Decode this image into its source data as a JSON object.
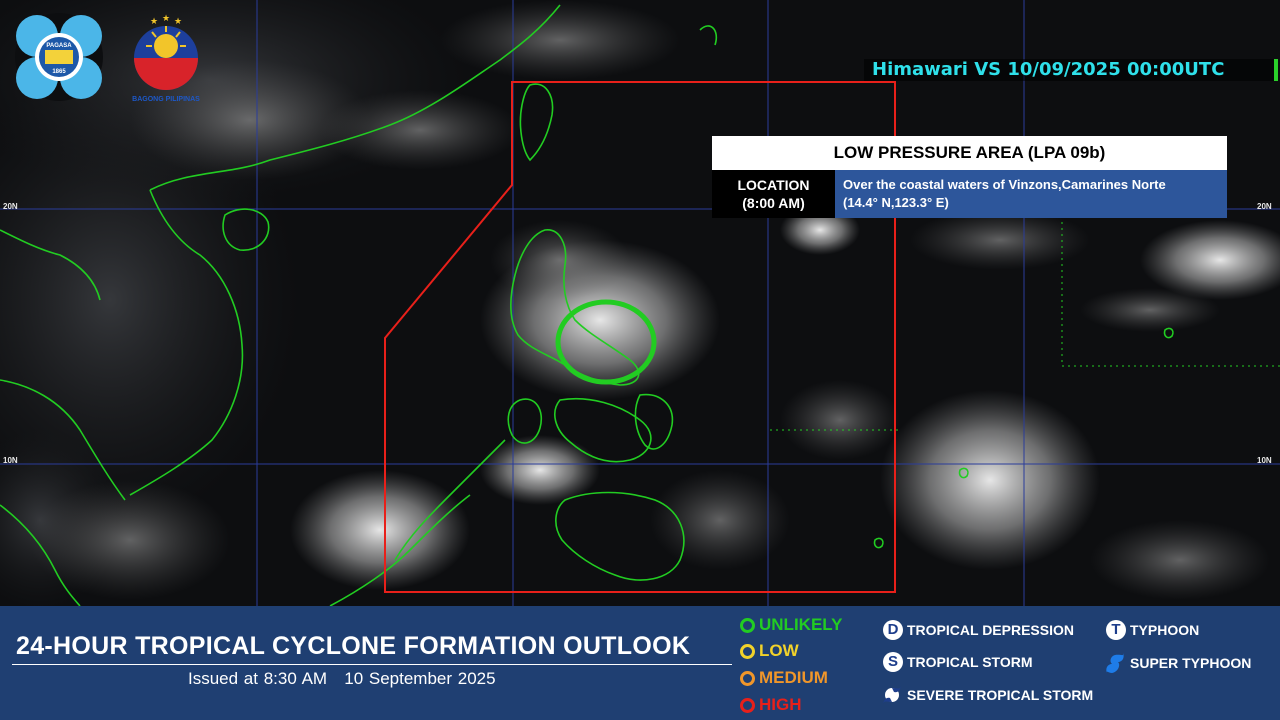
{
  "satellite": {
    "caption": "Himawari VS 10/09/2025 00:00UTC"
  },
  "logos": {
    "pagasa_text": "PAGASA",
    "pagasa_year": "1865",
    "bagong_pilipinas_text": "BAGONG PILIPINAS"
  },
  "latitude_labels": {
    "lat20_left": "20N",
    "lat20_right": "20N",
    "lat10_left": "10N",
    "lat10_right": "10N"
  },
  "lpa_info": {
    "title": "LOW PRESSURE AREA (LPA 09b)",
    "location_label": "LOCATION",
    "location_time": "(8:00 AM)",
    "location_line1": "Over the coastal waters of Vinzons,Camarines Norte",
    "location_line2": "(14.4° N,123.3° E)",
    "likelihood_color": "#22cc22"
  },
  "footer": {
    "title": "24-HOUR TROPICAL CYCLONE FORMATION OUTLOOK",
    "issued": "Issued at 8:30 AM   10 September 2025"
  },
  "likelihood_legend": [
    {
      "label": "UNLIKELY",
      "color": "#22cc22"
    },
    {
      "label": "LOW",
      "color": "#f2d22a"
    },
    {
      "label": "MEDIUM",
      "color": "#f0962a"
    },
    {
      "label": "HIGH",
      "color": "#e8201a"
    }
  ],
  "cyclone_legend": [
    {
      "symbol": "D",
      "label": "TROPICAL DEPRESSION",
      "icon": "depression-badge-icon"
    },
    {
      "symbol": "S",
      "label": "TROPICAL STORM",
      "icon": "storm-badge-icon"
    },
    {
      "symbol": "",
      "label": "SEVERE TROPICAL STORM",
      "icon": "severe-storm-icon"
    },
    {
      "symbol": "T",
      "label": "TYPHOON",
      "icon": "typhoon-badge-icon"
    },
    {
      "symbol": "",
      "label": "SUPER TYPHOON",
      "icon": "super-typhoon-icon"
    }
  ],
  "colors": {
    "par_boundary": "#e8201a",
    "coastline": "#22cc22",
    "grid": "#2a3c9a",
    "footer_bg": "#1f3f72",
    "caption": "#2fe0ea"
  }
}
